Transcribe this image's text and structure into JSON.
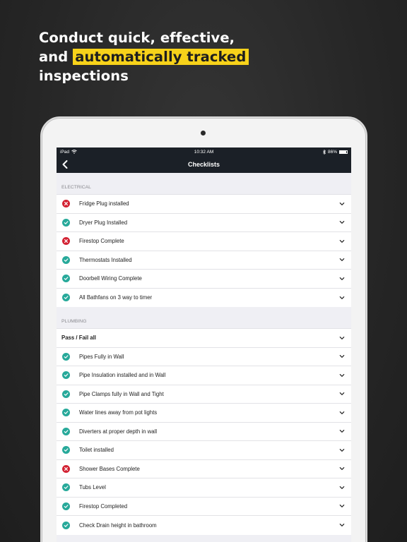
{
  "headline": {
    "line1": "Conduct quick, effective,",
    "line2_prefix": "and",
    "line2_highlight": "automatically tracked",
    "line3": "inspections",
    "highlight_color": "#f7d21a"
  },
  "status_bar": {
    "carrier": "iPad",
    "time": "10:32 AM",
    "battery": "86%"
  },
  "nav": {
    "title": "Checklists",
    "back_icon": "chevron-left-icon"
  },
  "sections": [
    {
      "header": "ELECTRICAL",
      "items": [
        {
          "label": "Fridge Plug installed",
          "status": "fail"
        },
        {
          "label": "Dryer Plug Installed",
          "status": "pass"
        },
        {
          "label": "Firestop Complete",
          "status": "fail"
        },
        {
          "label": "Thermostats Installed",
          "status": "pass"
        },
        {
          "label": "Doorbell Wiring Complete",
          "status": "pass"
        },
        {
          "label": "All Bathfans on 3 way to timer",
          "status": "pass"
        }
      ]
    },
    {
      "header": "PLUMBING",
      "bulk_label": "Pass / Fail all",
      "items": [
        {
          "label": "Pipes Fully in Wall",
          "status": "pass"
        },
        {
          "label": "Pipe Insulation installed and in Wall",
          "status": "pass"
        },
        {
          "label": "Pipe Clamps fully in Wall and Tight",
          "status": "pass"
        },
        {
          "label": "Water lines away from pot lights",
          "status": "pass"
        },
        {
          "label": "Diverters at proper depth in wall",
          "status": "pass"
        },
        {
          "label": "Toilet installed",
          "status": "pass"
        },
        {
          "label": "Shower Bases Complete",
          "status": "fail"
        },
        {
          "label": "Tubs Level",
          "status": "pass"
        },
        {
          "label": "Firestop Completed",
          "status": "pass"
        },
        {
          "label": "Check Drain height in bathroom",
          "status": "pass"
        }
      ]
    }
  ],
  "colors": {
    "pass": "#27a99a",
    "fail": "#d32334",
    "nav_bg": "#1b2027"
  }
}
